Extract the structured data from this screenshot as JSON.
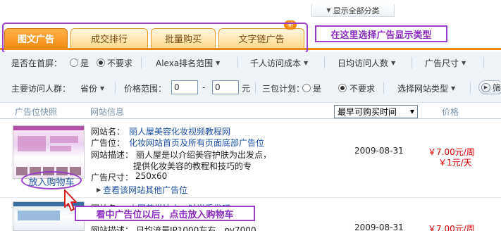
{
  "top": {
    "show_all_label": "显示全部分类"
  },
  "tabs": [
    {
      "label": "图文广告",
      "active": true
    },
    {
      "label": "成交排行",
      "active": false
    },
    {
      "label": "批量购买",
      "active": false
    },
    {
      "label": "文字链广告",
      "active": false
    }
  ],
  "tab_badge": "新",
  "annotations": {
    "select_type": "在这里选择广告显示类型",
    "add_to_cart_hint": "看中广告位以后，点击放入购物车"
  },
  "filters": {
    "row1": {
      "homepage_label": "是否在首屏：",
      "opt_yes": "是",
      "opt_no": "不要求",
      "selected": "不要求",
      "alexa": "Alexa排名范围",
      "cpm": "千人访问成本",
      "daily_visits": "日均访问人数",
      "ad_size": "广告尺寸"
    },
    "row2": {
      "audience_label": "主要访问人群：",
      "province": "省份",
      "price_range_label": "价格范围：",
      "price_min": "0",
      "price_max": "0",
      "currency_unit": "元",
      "guarantee_label": "三包计划：",
      "opt_yes": "是",
      "opt_no": "不要求",
      "selected": "不要求",
      "site_type": "选择网站类型",
      "filter_btn": "筛"
    }
  },
  "table_header": {
    "col_snapshot": "广告位快照",
    "col_site_info": "网站信息",
    "sort_label": "最早可购买时间",
    "col_price": "价格"
  },
  "listings": [
    {
      "site_name_label": "网站名：",
      "site_name": "丽人屋美容化妆视频教程网",
      "ad_slot_label": "广告位：",
      "ad_slot": "化妆网站首页及所有页面底部广告位",
      "desc_label": "网站描述：",
      "desc_line1": "丽人屋是以介绍美容护肤为出发点，",
      "desc_line2": "提供化妆美容的教程和技巧的专",
      "size_label": "广告尺寸：",
      "size": "250x60",
      "more_link": "查看该网站其他广告位",
      "date": "2009-08-31",
      "price_week": "￥7.00元/周",
      "price_day": "￥1元/天",
      "cart_button": "放入购物车"
    },
    {
      "site_name_label": "网站名：",
      "site_name": "中国美发达人 - 时尚秀发吧",
      "desc_label": "网站描述：",
      "desc_line1": "日均流量IP1000左右，pv7000",
      "date": "2009-08-31",
      "price_week": "￥7.00元/周"
    }
  ]
}
